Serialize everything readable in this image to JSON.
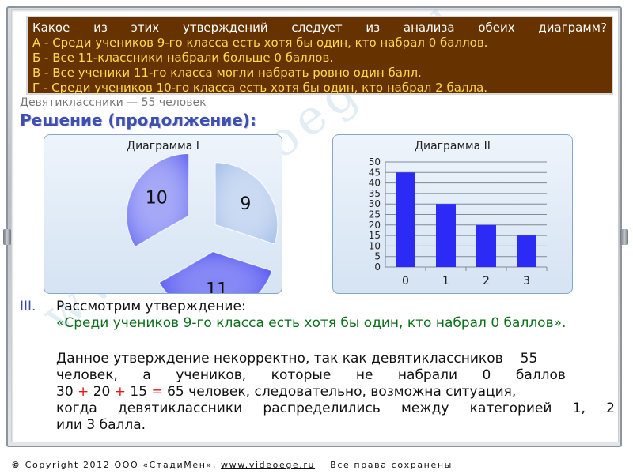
{
  "question": {
    "text_words": [
      "Какое",
      "из",
      "этих",
      "утверждений",
      "следует",
      "из",
      "анализа",
      "обеих",
      "диаграмм?"
    ],
    "options": [
      "А  - Среди учеников 9-го класса есть хотя бы один, кто набрал 0 баллов.",
      "Б  - Все 11-классники набрали больше 0 баллов.",
      "В  - Все ученики 11-го класса могли набрать ровно один балл.",
      "Г  - Среди учеников 10-го класса есть хотя бы один, кто набрал 2 балла."
    ]
  },
  "ninth_grade_note": "Девятиклассники — 55 человек",
  "section_title": "Решение (продолжение):",
  "chart_data": [
    {
      "type": "pie",
      "title": "Диаграмма I",
      "labels": [
        "9",
        "11",
        "10"
      ],
      "values": [
        9,
        11,
        10
      ],
      "colors": [
        "#a9c3ea",
        "#3b3ef0",
        "#6d72f2"
      ]
    },
    {
      "type": "bar",
      "title": "Диаграмма II",
      "categories": [
        "0",
        "1",
        "2",
        "3"
      ],
      "values": [
        45,
        30,
        20,
        15
      ],
      "ylim": [
        0,
        50
      ],
      "yticks": [
        "0",
        "5",
        "10",
        "15",
        "20",
        "25",
        "30",
        "35",
        "40",
        "45",
        "50"
      ],
      "grid": true,
      "color": "#2b2bf5"
    }
  ],
  "solution": {
    "numeral": "III.",
    "intro": "Рассмотрим утверждение:",
    "quote": "«Среди учеников 9-го класса есть хотя бы один, кто набрал 0 баллов».",
    "line1": "Данное утверждение некорректно, так как девятиклассников",
    "line1_num": "55",
    "line2_words": [
      "человек,",
      "а",
      "учеников,",
      "которые",
      "не",
      "набрали",
      "0",
      "баллов"
    ],
    "eq": {
      "a": "30",
      "plus1": "+",
      "b": "20",
      "plus2": "+",
      "c": "15",
      "eqsign": "=",
      "rest": "65 человек, следовательно, возможна ситуация,"
    },
    "line4_words": [
      "когда",
      "девятиклассники",
      "распределились",
      "между",
      "категорией",
      "1,",
      "2"
    ],
    "line5": "или 3 балла."
  },
  "footer": {
    "copyright_symbol": "©",
    "text": "Copyright 2012 ООО «СтадиМен»,",
    "link": "www.videoege.ru",
    "rights": "Все права сохранены"
  },
  "watermark": "www.videoege.ru"
}
